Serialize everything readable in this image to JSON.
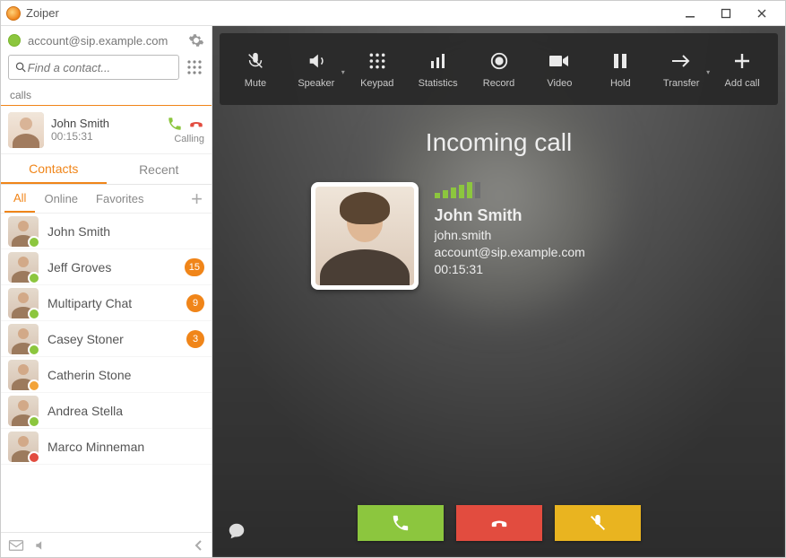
{
  "app": {
    "title": "Zoiper"
  },
  "account": {
    "address": "account@sip.example.com"
  },
  "search": {
    "placeholder": "Find a contact..."
  },
  "calls_section": {
    "label": "calls"
  },
  "active_call": {
    "name": "John Smith",
    "duration": "00:15:31",
    "status": "Calling"
  },
  "tabs": {
    "contacts": "Contacts",
    "recent": "Recent",
    "active": "contacts"
  },
  "subtabs": {
    "all": "All",
    "online": "Online",
    "favorites": "Favorites",
    "active": "all"
  },
  "contacts": [
    {
      "name": "John Smith",
      "presence": "online",
      "badge": ""
    },
    {
      "name": "Jeff Groves",
      "presence": "online",
      "badge": "15"
    },
    {
      "name": "Multiparty Chat",
      "presence": "online",
      "badge": "9"
    },
    {
      "name": "Casey Stoner",
      "presence": "online",
      "badge": "3"
    },
    {
      "name": "Catherin Stone",
      "presence": "away",
      "badge": ""
    },
    {
      "name": "Andrea Stella",
      "presence": "online",
      "badge": ""
    },
    {
      "name": "Marco Minneman",
      "presence": "dnd",
      "badge": ""
    }
  ],
  "toolbar": {
    "mute": "Mute",
    "speaker": "Speaker",
    "keypad": "Keypad",
    "statistics": "Statistics",
    "record": "Record",
    "video": "Video",
    "hold": "Hold",
    "transfer": "Transfer",
    "addcall": "Add call"
  },
  "incoming": {
    "title": "Incoming call",
    "name": "John Smith",
    "user": "john.smith",
    "address": "account@sip.example.com",
    "duration": "00:15:31"
  },
  "colors": {
    "accent": "#f08519",
    "green": "#8cc63e",
    "red": "#e24c3f",
    "yellow": "#e9b420"
  }
}
